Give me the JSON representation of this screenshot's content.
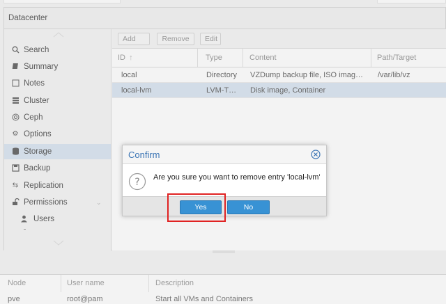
{
  "datacenter": {
    "title": "Datacenter"
  },
  "nav": {
    "items": [
      {
        "label": "Search",
        "icon": "search-icon"
      },
      {
        "label": "Summary",
        "icon": "book-icon"
      },
      {
        "label": "Notes",
        "icon": "notes-icon"
      },
      {
        "label": "Cluster",
        "icon": "server-icon"
      },
      {
        "label": "Ceph",
        "icon": "ceph-icon"
      },
      {
        "label": "Options",
        "icon": "gear-icon"
      },
      {
        "label": "Storage",
        "icon": "database-icon",
        "selected": true
      },
      {
        "label": "Backup",
        "icon": "floppy-icon"
      },
      {
        "label": "Replication",
        "icon": "retweet-icon"
      },
      {
        "label": "Permissions",
        "icon": "unlock-icon"
      },
      {
        "label": "Users",
        "icon": "user-icon"
      }
    ]
  },
  "toolbar": {
    "add_label": "Add",
    "remove_label": "Remove",
    "edit_label": "Edit"
  },
  "grid": {
    "columns": [
      "ID",
      "Type",
      "Content",
      "Path/Target"
    ],
    "rows": [
      {
        "id": "local",
        "type": "Directory",
        "content": "VZDump backup file, ISO imag…",
        "path": "/var/lib/vz"
      },
      {
        "id": "local-lvm",
        "type": "LVM-T…",
        "content": "Disk image, Container",
        "path": ""
      }
    ]
  },
  "bottom": {
    "columns": [
      "Node",
      "User name",
      "Description"
    ],
    "row": {
      "node": "pve",
      "user": "root@pam",
      "description": "Start all VMs and Containers"
    }
  },
  "dialog": {
    "title": "Confirm",
    "message": "Are you sure you want to remove entry 'local-lvm'",
    "yes_label": "Yes",
    "no_label": "No"
  },
  "colors": {
    "accent": "#3892d4",
    "title": "#3a74b4",
    "selected_row": "#dbe6f2",
    "highlight": "#e02222"
  }
}
